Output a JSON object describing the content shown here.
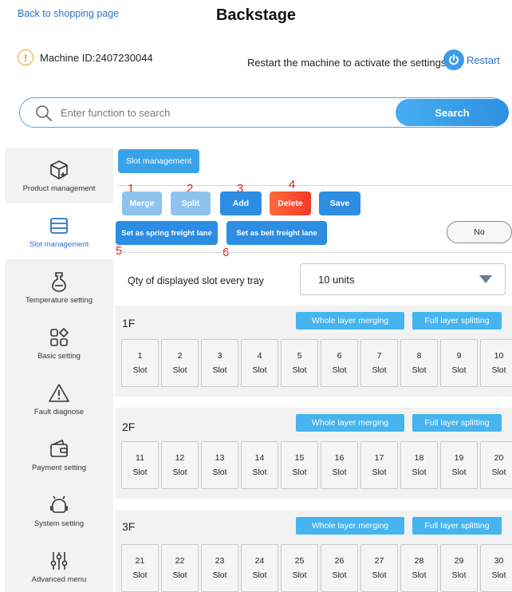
{
  "header": {
    "back_link": "Back to shopping page",
    "title": "Backstage"
  },
  "machine": {
    "id_text": "Machine ID:2407230044",
    "restart_note": "Restart the machine to activate the settings",
    "restart_label": "Restart"
  },
  "search": {
    "placeholder": "Enter function to search",
    "button": "Search"
  },
  "sidebar": {
    "items": [
      {
        "label": "Product management",
        "icon": "box-icon"
      },
      {
        "label": "Slot management",
        "icon": "slot-tray-icon",
        "active": true
      },
      {
        "label": "Temperature setting",
        "icon": "temperature-icon"
      },
      {
        "label": "Basic setting",
        "icon": "basic-grid-icon"
      },
      {
        "label": "Fault diagnose",
        "icon": "warning-icon"
      },
      {
        "label": "Payment setting",
        "icon": "wallet-icon"
      },
      {
        "label": "System setting",
        "icon": "robot-icon"
      },
      {
        "label": "Advanced menu",
        "icon": "sliders-icon"
      }
    ]
  },
  "main": {
    "section_tag": "Slot management",
    "actions": {
      "merge": "Merge",
      "split": "Split",
      "add": "Add",
      "delete": "Delete",
      "save": "Save",
      "spring": "Set as spring freight lane",
      "belt": "Set as belt freight lane",
      "no_toggle": "No"
    },
    "annotations": [
      "1",
      "2",
      "3",
      "4",
      "5",
      "6"
    ],
    "qty": {
      "label": "Qty of displayed slot every tray",
      "value": "10 units"
    },
    "layer_buttons": {
      "merge": "Whole layer merging",
      "split": "Full layer splitting"
    },
    "slot_word": "Slot",
    "layers": [
      {
        "name": "1F",
        "slots": [
          "1",
          "2",
          "3",
          "4",
          "5",
          "6",
          "7",
          "8",
          "9",
          "10"
        ]
      },
      {
        "name": "2F",
        "slots": [
          "11",
          "12",
          "13",
          "14",
          "15",
          "16",
          "17",
          "18",
          "19",
          "20"
        ]
      },
      {
        "name": "3F",
        "slots": [
          "21",
          "22",
          "23",
          "24",
          "25",
          "26",
          "27",
          "28",
          "29",
          "30"
        ]
      }
    ]
  },
  "colors": {
    "accent": "#2c8de2",
    "light_accent": "#8ec3ef",
    "danger": "#f23a2a",
    "annotation": "#e02020",
    "warning": "#f0a020"
  }
}
